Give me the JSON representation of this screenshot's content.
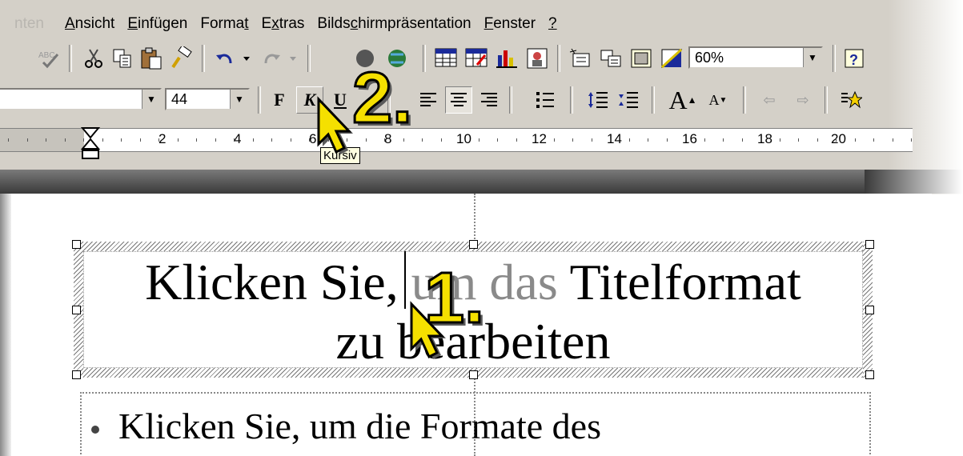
{
  "menubar": {
    "items": [
      {
        "label": "nten",
        "underline": ""
      },
      {
        "label": "Ansicht",
        "underline": "A"
      },
      {
        "label": "Einfügen",
        "underline": "E"
      },
      {
        "label": "Format",
        "underline": "t"
      },
      {
        "label": "Extras",
        "underline": "x"
      },
      {
        "label": "Bildschirmpräsentation",
        "underline": "c"
      },
      {
        "label": "Fenster",
        "underline": "F"
      },
      {
        "label": "?",
        "underline": "?"
      }
    ]
  },
  "standard_toolbar": {
    "zoom_value": "60%",
    "icons": [
      "spellcheck-icon",
      "cut-icon",
      "copy-icon",
      "paste-icon",
      "format-painter-icon",
      "undo-icon",
      "redo-icon",
      "hyperlink-icon",
      "insert-table-icon",
      "tables-borders-icon",
      "chart-icon",
      "clipart-icon",
      "new-slide-icon",
      "expand-icon",
      "show-formatting-icon",
      "grayscale-icon",
      "help-icon"
    ]
  },
  "formatting_toolbar": {
    "font_size_value": "44",
    "bold_label": "F",
    "italic_label": "K",
    "underline_label": "U",
    "increase_font_label": "A",
    "decrease_font_label": "A"
  },
  "ruler": {
    "labels": [
      "2",
      "4",
      "6",
      "8",
      "10",
      "12",
      "14",
      "16",
      "18",
      "20"
    ]
  },
  "tooltip": {
    "text": "Kursiv"
  },
  "slide": {
    "title_part1": "Klicken Sie, ",
    "title_part2": "um das",
    "title_part3": " Titelformat",
    "title_line2_a": "zu b",
    "title_line2_b": "earbeiten",
    "body_line": "Klicken Sie, um die Formate des"
  },
  "step_markers": {
    "step1": "1.",
    "step2": "2."
  }
}
